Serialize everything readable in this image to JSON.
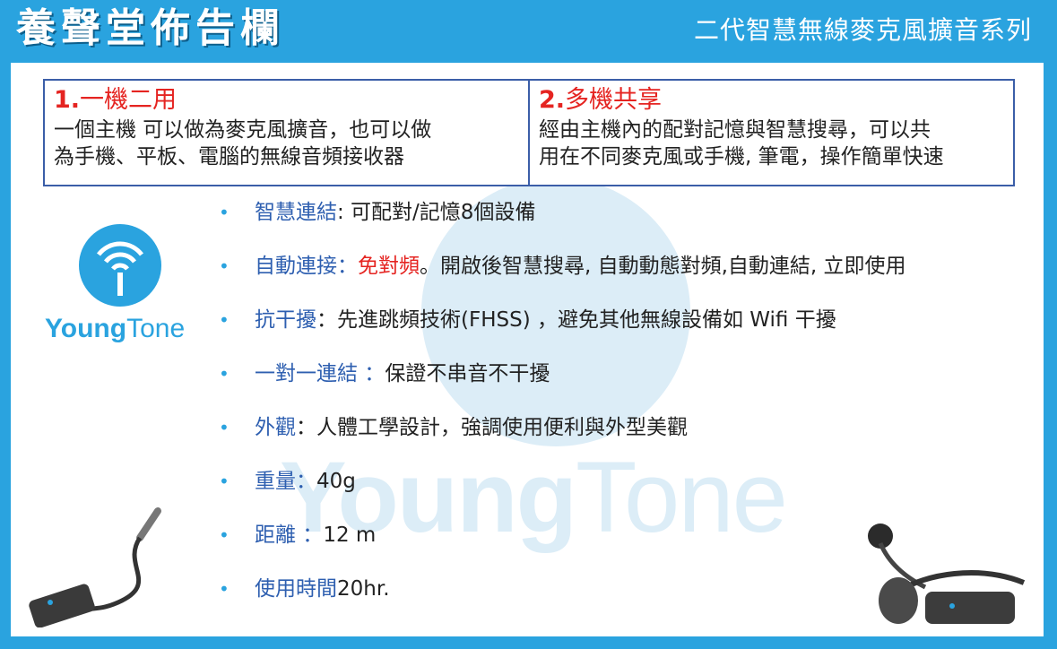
{
  "header": {
    "title": "養聲堂佈告欄",
    "subtitle": "二代智慧無線麥克風擴音系列"
  },
  "watermark": {
    "part1": "Young",
    "part2": "Tone"
  },
  "logo": {
    "brand_bold": "Young",
    "brand_thin": "Tone"
  },
  "features": [
    {
      "number": "1.",
      "title": "一機二用",
      "line1": "一個主機 可以做為麥克風擴音，也可以做",
      "line2": "為手機、平板、電腦的無線音頻接收器"
    },
    {
      "number": "2.",
      "title": "多機共享",
      "line1": "經由主機內的配對記憶與智慧搜尋，可以共",
      "line2": "用在不同麥克風或手機, 筆電，操作簡單快速"
    }
  ],
  "bullets": [
    {
      "key": "智慧連結",
      "value": ": 可配對/記憶8個設備"
    },
    {
      "key": "自動連接：",
      "red": "免對頻",
      "value": "。開啟後智慧搜尋, 自動動態對頻,自動連結, 立即使用"
    },
    {
      "key": "抗干擾",
      "value": "：先進跳頻技術(FHSS) ，避免其他無線設備如 Wifi 干擾"
    },
    {
      "key": "一對一連結 ：",
      "value": "保證不串音不干擾"
    },
    {
      "key": "外觀",
      "value": "：人體工學設計，強調使用便利與外型美觀"
    },
    {
      "key": "重量：",
      "value": "40g"
    },
    {
      "key": "距離 ：",
      "value": "12 m"
    },
    {
      "key": "使用時間",
      "value": "20hr."
    }
  ],
  "bullet_glyph": "•",
  "colors": {
    "frame": "#2aa3df",
    "accent_red": "#e52421",
    "key_blue": "#2e5fb0",
    "table_border": "#3b5ea8"
  },
  "icons": [
    "youngtone-logo-icon",
    "wireless-receiver-image",
    "headset-microphone-image"
  ]
}
